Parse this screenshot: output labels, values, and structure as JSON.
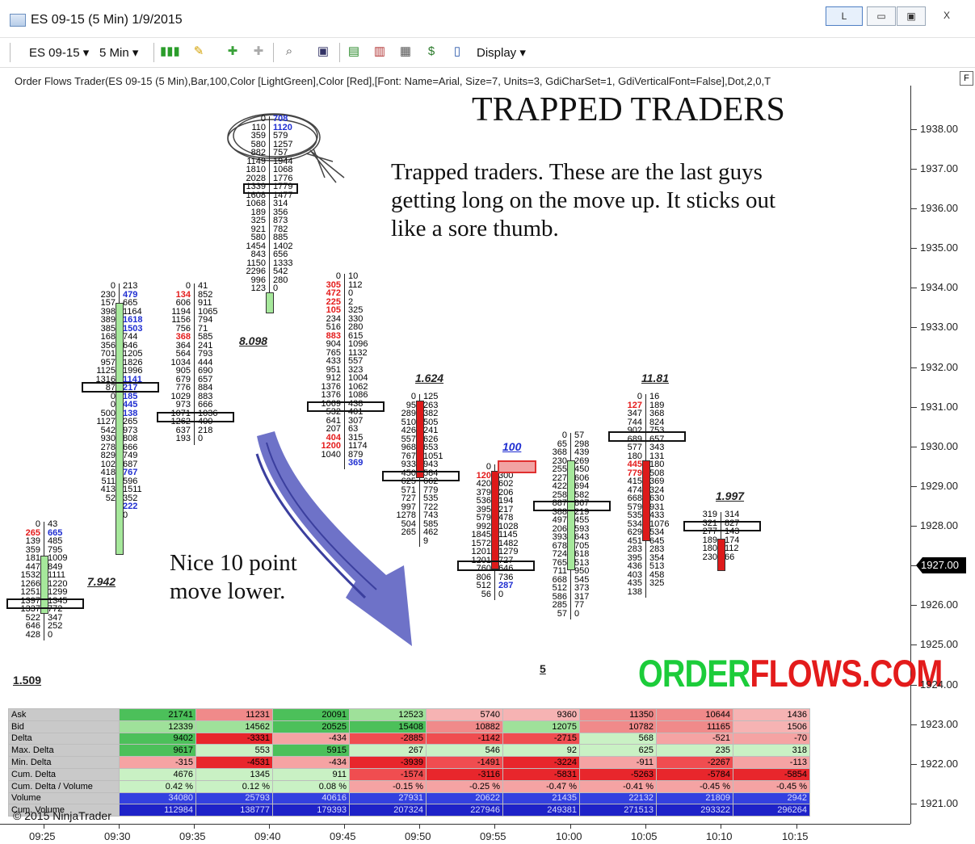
{
  "window": {
    "title": "ES 09-15 (5 Min)  1/9/2015",
    "buttons": [
      "L",
      "▭",
      "▣",
      "X"
    ]
  },
  "toolbar": {
    "instrument": "ES 09-15",
    "interval": "5 Min",
    "display": "Display"
  },
  "indicator_label": "Order Flows Trader(ES 09-15 (5 Min),Bar,100,Color [LightGreen],Color [Red],[Font: Name=Arial, Size=7, Units=3, GdiCharSet=1, GdiVerticalFont=False],Dot,2,0,T",
  "f_button": "F",
  "annotations": {
    "title": "TRAPPED TRADERS",
    "trapped": "Trapped traders. These are the last guys getting long on the move up. It sticks out like a sore thumb.",
    "trapped_lines": [
      "Trapped traders. These are the last guys",
      "getting long on the move up. It sticks out",
      "like a sore thumb."
    ],
    "move_lines": [
      "Nice 10 point",
      "move lower."
    ]
  },
  "brand": {
    "part1": "ORDER",
    "part2": "FLOWS.COM"
  },
  "copyright": "© 2015 NinjaTrader",
  "price_axis": {
    "labels": [
      "1938.00",
      "1937.00",
      "1936.00",
      "1935.00",
      "1934.00",
      "1933.00",
      "1932.00",
      "1931.00",
      "1930.00",
      "1929.00",
      "1928.00",
      "1927.00",
      "1926.00",
      "1925.00",
      "1924.00",
      "1923.00",
      "1922.00",
      "1921.00"
    ],
    "current": "1927.00"
  },
  "time_axis": [
    "09:25",
    "09:30",
    "09:35",
    "09:40",
    "09:45",
    "09:50",
    "09:55",
    "10:00",
    "10:05",
    "10:10",
    "10:15"
  ],
  "bar_labels": [
    "1.509",
    "7.942",
    "8.098",
    "1.624",
    "100",
    "5",
    "11.81",
    "1.997"
  ],
  "colors": {
    "bid_red": "#e41b1b",
    "ask_blue": "#1f2ed1",
    "green_candle": "#a6e89b",
    "red_candle": "#dd1a1a",
    "circle": "#444444",
    "arrow": "#4b4fb2"
  },
  "ladders": [
    {
      "bid": [
        "0",
        "265",
        "139",
        "359",
        "181",
        "447",
        "1532",
        "1266",
        "1251",
        "1397",
        "1337",
        "522",
        "646",
        "428"
      ],
      "ask": [
        "43",
        "665",
        "485",
        "795",
        "1009",
        "849",
        "1111",
        "1220",
        "1299",
        "1345",
        "772",
        "347",
        "252",
        "0"
      ]
    },
    {
      "bid": [
        "0",
        "230",
        "157",
        "398",
        "389",
        "385",
        "168",
        "356",
        "701",
        "957",
        "1125",
        "1316",
        "87",
        "0",
        "0",
        "500",
        "1127",
        "542",
        "930",
        "278",
        "829",
        "102",
        "418",
        "511",
        "413",
        "52"
      ],
      "ask": [
        "213",
        "479",
        "665",
        "1164",
        "1618",
        "1503",
        "744",
        "646",
        "1205",
        "1826",
        "1996",
        "1141",
        "217",
        "185",
        "445",
        "138",
        "265",
        "973",
        "808",
        "666",
        "749",
        "687",
        "767",
        "596",
        "1511",
        "352",
        "222",
        "0"
      ]
    },
    {
      "bid": [
        "0",
        "134",
        "606",
        "1194",
        "1156",
        "756",
        "368",
        "364",
        "564",
        "1034",
        "905",
        "679",
        "776",
        "1029",
        "973",
        "1071",
        "1262",
        "637",
        "193"
      ],
      "ask": [
        "41",
        "852",
        "911",
        "1065",
        "794",
        "71",
        "585",
        "241",
        "793",
        "444",
        "690",
        "657",
        "884",
        "883",
        "666",
        "1036",
        "400",
        "218",
        "0"
      ]
    },
    {
      "bid": [
        "0",
        "110",
        "359",
        "580",
        "882",
        "1149",
        "1810",
        "2028",
        "1339",
        "1608",
        "1068",
        "189",
        "325",
        "921",
        "580",
        "1454",
        "843",
        "1150",
        "2296",
        "996",
        "123"
      ],
      "ask": [
        "708",
        "1120",
        "579",
        "1257",
        "757",
        "1944",
        "1068",
        "1776",
        "1779",
        "1477",
        "314",
        "356",
        "873",
        "782",
        "885",
        "1402",
        "656",
        "1333",
        "542",
        "280",
        "0"
      ]
    },
    {
      "bid": [
        "0",
        "305",
        "472",
        "225",
        "105",
        "234",
        "516",
        "883",
        "904",
        "765",
        "433",
        "951",
        "912",
        "1376",
        "1376",
        "1069",
        "532",
        "641",
        "207",
        "404",
        "1200",
        "1040"
      ],
      "ask": [
        "10",
        "112",
        "0",
        "2",
        "325",
        "330",
        "280",
        "615",
        "1096",
        "1132",
        "557",
        "323",
        "1004",
        "1062",
        "1086",
        "438",
        "401",
        "307",
        "63",
        "315",
        "1174",
        "879",
        "369"
      ]
    },
    {
      "bid": [
        "0",
        "95",
        "289",
        "510",
        "426",
        "557",
        "968",
        "767",
        "933",
        "450",
        "625",
        "571",
        "727",
        "997",
        "1278",
        "504",
        "265"
      ],
      "ask": [
        "125",
        "263",
        "382",
        "505",
        "241",
        "626",
        "653",
        "1051",
        "943",
        "584",
        "662",
        "779",
        "535",
        "722",
        "743",
        "585",
        "462",
        "9"
      ]
    },
    {
      "bid": [
        "0",
        "120",
        "420",
        "379",
        "536",
        "395",
        "579",
        "992",
        "1845",
        "1572",
        "1201",
        "1201",
        "760",
        "806",
        "512",
        "56"
      ],
      "ask": [
        "0",
        "300",
        "602",
        "206",
        "194",
        "217",
        "478",
        "1028",
        "1145",
        "1482",
        "1279",
        "727",
        "646",
        "736",
        "287",
        "0"
      ]
    },
    {
      "bid": [
        "0",
        "65",
        "368",
        "230",
        "255",
        "227",
        "422",
        "258",
        "887",
        "388",
        "497",
        "206",
        "393",
        "678",
        "724",
        "765",
        "711",
        "668",
        "512",
        "586",
        "285",
        "57"
      ],
      "ask": [
        "57",
        "298",
        "439",
        "269",
        "450",
        "606",
        "694",
        "582",
        "867",
        "219",
        "455",
        "593",
        "643",
        "705",
        "618",
        "513",
        "950",
        "545",
        "373",
        "317",
        "77",
        "0"
      ]
    },
    {
      "bid": [
        "0",
        "127",
        "347",
        "744",
        "902",
        "689",
        "577",
        "180",
        "445",
        "779",
        "415",
        "474",
        "668",
        "579",
        "535",
        "534",
        "629",
        "451",
        "283",
        "395",
        "436",
        "403",
        "435",
        "138"
      ],
      "ask": [
        "16",
        "189",
        "368",
        "824",
        "753",
        "657",
        "343",
        "131",
        "180",
        "508",
        "369",
        "324",
        "630",
        "931",
        "433",
        "1076",
        "534",
        "645",
        "283",
        "354",
        "513",
        "458",
        "325"
      ]
    },
    {
      "bid": [
        "319",
        "321",
        "277",
        "189",
        "180",
        "230"
      ],
      "ask": [
        "314",
        "827",
        "143",
        "174",
        "112",
        "66"
      ]
    }
  ],
  "stats": {
    "rows": [
      "Ask",
      "Bid",
      "Delta",
      "Max. Delta",
      "Min. Delta",
      "Cum. Delta",
      "Cum. Delta / Volume",
      "Volume",
      "Cum. Volume"
    ],
    "values": [
      [
        "21741",
        "11231",
        "20091",
        "12523",
        "5740",
        "9360",
        "11350",
        "10644",
        "1436"
      ],
      [
        "12339",
        "14562",
        "20525",
        "15408",
        "10882",
        "12075",
        "10782",
        "11165",
        "1506"
      ],
      [
        "9402",
        "-3331",
        "-434",
        "-2885",
        "-1142",
        "-2715",
        "568",
        "-521",
        "-70"
      ],
      [
        "9617",
        "553",
        "5915",
        "267",
        "546",
        "92",
        "625",
        "235",
        "318"
      ],
      [
        "-315",
        "-4531",
        "-434",
        "-3939",
        "-1491",
        "-3224",
        "-911",
        "-2267",
        "-113"
      ],
      [
        "4676",
        "1345",
        "911",
        "-1574",
        "-3116",
        "-5831",
        "-5263",
        "-5784",
        "-5854"
      ],
      [
        "0.42 %",
        "0.12 %",
        "0.08 %",
        "-0.15 %",
        "-0.25 %",
        "-0.47 %",
        "-0.41 %",
        "-0.45 %",
        "-0.45 %"
      ],
      [
        "34080",
        "25793",
        "40616",
        "27931",
        "20622",
        "21435",
        "22132",
        "21809",
        "2942"
      ],
      [
        "112984",
        "138777",
        "179393",
        "207324",
        "227946",
        "249381",
        "271513",
        "293322",
        "296264"
      ]
    ]
  }
}
